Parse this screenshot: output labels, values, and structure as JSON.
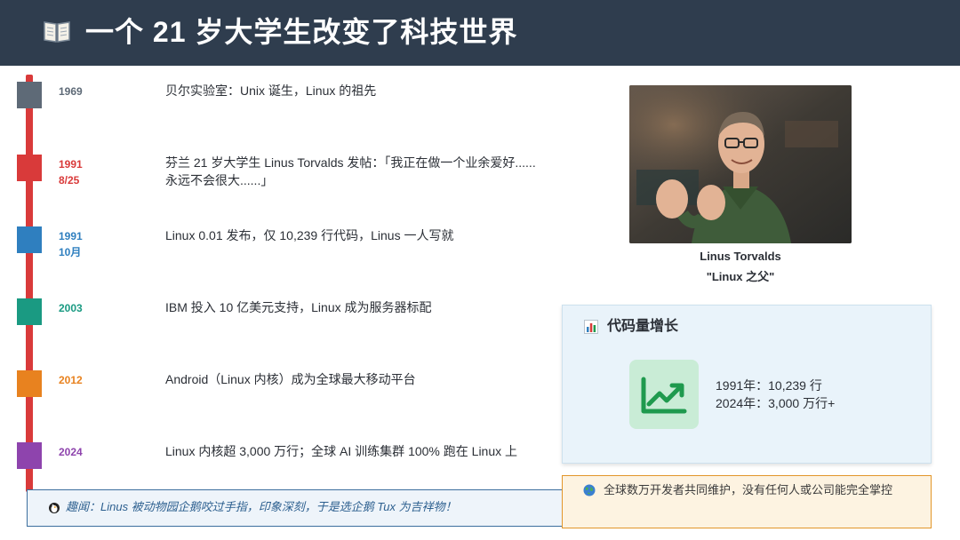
{
  "header": {
    "icon": "open-book-icon",
    "title": "一个 21 岁大学生改变了科技世界"
  },
  "timeline": [
    {
      "date_line1": "1969",
      "date_line2": "",
      "text": "贝尔实验室：Unix 诞生，Linux 的祖先",
      "color": "#5e6a77"
    },
    {
      "date_line1": "1991",
      "date_line2": "8/25",
      "text": "芬兰 21 岁大学生 Linus Torvalds 发帖：「我正在做一个业余爱好......永远不会很大......」",
      "color": "#d93a3a"
    },
    {
      "date_line1": "1991",
      "date_line2": "10月",
      "text": "Linux 0.01 发布，仅 10,239 行代码，Linus 一人写就",
      "color": "#2f7fbf"
    },
    {
      "date_line1": "2003",
      "date_line2": "",
      "text": "IBM 投入 10 亿美元支持，Linux 成为服务器标配",
      "color": "#1a9a82"
    },
    {
      "date_line1": "2012",
      "date_line2": "",
      "text": "Android（Linux 内核）成为全球最大移动平台",
      "color": "#e8821f"
    },
    {
      "date_line1": "2024",
      "date_line2": "",
      "text": "Linux 内核超 3,000 万行；全球 AI 训练集群 100% 跑在 Linux 上",
      "color": "#8e44ad"
    }
  ],
  "photo": {
    "caption_name": "Linus Torvalds",
    "caption_title": "\"Linux 之父\""
  },
  "code_panel": {
    "icon": "bar-chart-icon",
    "title": "代码量增长",
    "growth_icon": "trending-up-icon",
    "stat_1991": "1991年：10,239 行",
    "stat_2024": "2024年：3,000 万行+"
  },
  "fun_fact": {
    "icon": "penguin-icon",
    "text": "趣闻：Linus 被动物园企鹅咬过手指，印象深刻，于是选企鹅 Tux 为吉祥物！"
  },
  "note": {
    "icon": "globe-icon",
    "text": "全球数万开发者共同维护，没有任何人或公司能完全掌控"
  },
  "colors": {
    "header_bg": "#2f3d4e",
    "timeline_line": "#d93a3a",
    "panel_bg": "#e9f3fa",
    "growth_green": "#1f9a4e",
    "note_border": "#e2962a"
  }
}
